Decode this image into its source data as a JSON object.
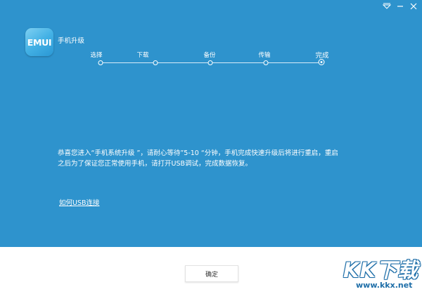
{
  "app": {
    "logo_text": "EMUI",
    "title": "手机升级"
  },
  "titlebar": {
    "icons": [
      "dropdown-icon",
      "minimize-icon",
      "close-icon"
    ]
  },
  "steps": [
    {
      "label": "选择",
      "state": "done"
    },
    {
      "label": "下载",
      "state": "done"
    },
    {
      "label": "备份",
      "state": "done"
    },
    {
      "label": "传输",
      "state": "done"
    },
    {
      "label": "完成",
      "state": "current"
    }
  ],
  "message": {
    "line1": "恭喜您进入“手机系统升级 ”，请耐心等待”5-10 “分钟，手机完成快速升级后将进行重启，重启",
    "line2": "之后为了保证您正常使用手机，请打开USB调试，完成数据恢复。"
  },
  "usb_link": "如何USB连接",
  "confirm_button": "确定",
  "watermark": {
    "logo_text": "KK下载",
    "url": "www.kkx.net"
  },
  "colors": {
    "background": "#2e93cd",
    "footer": "#ffffff",
    "watermark": "#1e6ea8"
  }
}
